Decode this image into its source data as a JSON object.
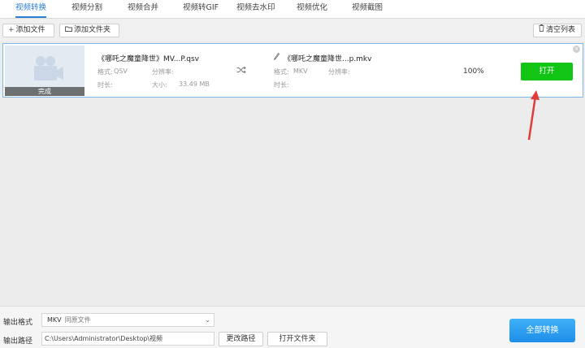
{
  "tabs": [
    {
      "label": "视频转换",
      "active": true
    },
    {
      "label": "视频分割",
      "active": false
    },
    {
      "label": "视频合并",
      "active": false
    },
    {
      "label": "视频转GIF",
      "active": false
    },
    {
      "label": "视频去水印",
      "active": false
    },
    {
      "label": "视频优化",
      "active": false
    },
    {
      "label": "视频截图",
      "active": false
    }
  ],
  "toolbar": {
    "add_file": "添加文件",
    "add_folder": "添加文件夹",
    "clear_list": "清空列表"
  },
  "file": {
    "thumb_status": "完成",
    "source_name": "《哪吒之魔童降世》MV...P.qsv",
    "source_format_label": "格式:",
    "source_format": "QSV",
    "source_resolution_label": "分辨率:",
    "source_duration_label": "时长:",
    "source_size_label": "大小:",
    "source_size": "33.49 MB",
    "output_name": "《哪吒之魔童降世...p.mkv",
    "output_format_label": "格式:",
    "output_format": "MKV",
    "output_resolution_label": "分辨率:",
    "output_duration_label": "时长:",
    "progress_text": "100%",
    "progress": 1.0,
    "open_label": "打开"
  },
  "bottom": {
    "format_label": "输出格式",
    "format_value": "MKV",
    "format_sub": "同原文件",
    "path_label": "输出路径",
    "path_value": "C:\\Users\\Administrator\\Desktop\\视频",
    "change_path": "更改路径",
    "open_folder": "打开文件夹",
    "convert_all": "全部转换"
  },
  "colors": {
    "accent": "#2a7fd4",
    "open_button": "#12c413",
    "convert_button": "#1e8ee8",
    "annotation_arrow": "#e23b3b"
  }
}
